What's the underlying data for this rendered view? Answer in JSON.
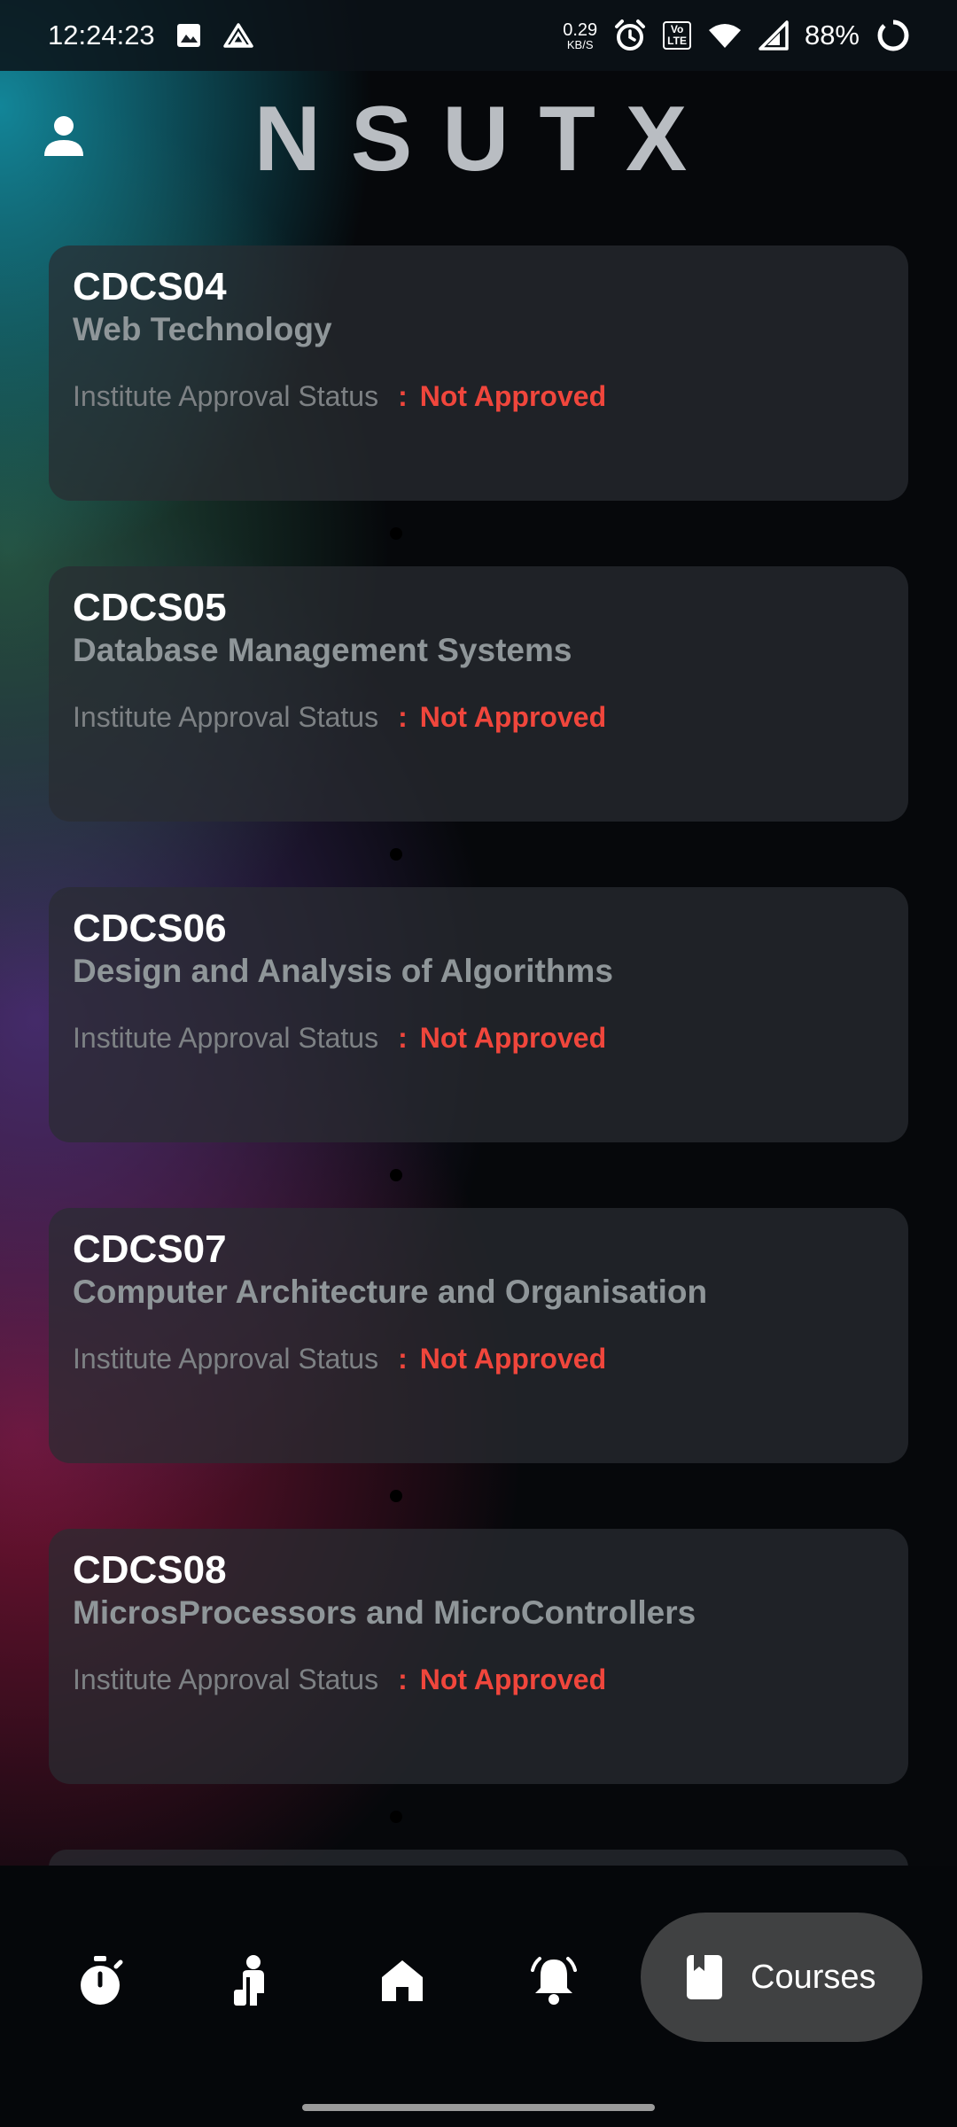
{
  "status_bar": {
    "time": "12:24:23",
    "net_speed_value": "0.29",
    "net_speed_unit": "KB/S",
    "volte_line1": "Vo",
    "volte_line2": "LTE",
    "battery": "88%"
  },
  "header": {
    "title": "NSUTX"
  },
  "courses": [
    {
      "code": "CDCS04",
      "name": "Web Technology",
      "status_label": "Institute Approval Status",
      "status_sep": ":",
      "status_value": "Not Approved"
    },
    {
      "code": "CDCS05",
      "name": "Database Management Systems",
      "status_label": "Institute Approval Status",
      "status_sep": ":",
      "status_value": "Not Approved"
    },
    {
      "code": "CDCS06",
      "name": "Design and Analysis of Algorithms",
      "status_label": "Institute Approval Status",
      "status_sep": ":",
      "status_value": "Not Approved"
    },
    {
      "code": "CDCS07",
      "name": "Computer Architecture and Organisation",
      "status_label": "Institute Approval Status",
      "status_sep": ":",
      "status_value": "Not Approved"
    },
    {
      "code": "CDCS08",
      "name": "MicrosProcessors and MicroControllers",
      "status_label": "Institute Approval Status",
      "status_sep": ":",
      "status_value": "Not Approved"
    }
  ],
  "bottom_nav": {
    "items": [
      {
        "icon": "stopwatch-icon"
      },
      {
        "icon": "person-icon"
      },
      {
        "icon": "home-icon"
      },
      {
        "icon": "bell-icon"
      }
    ],
    "active": {
      "icon": "book-icon",
      "label": "Courses"
    }
  },
  "colors": {
    "accent_status": "#f0463c",
    "active_nav_bg": "#404142",
    "card_bg": "#2a2c32"
  }
}
